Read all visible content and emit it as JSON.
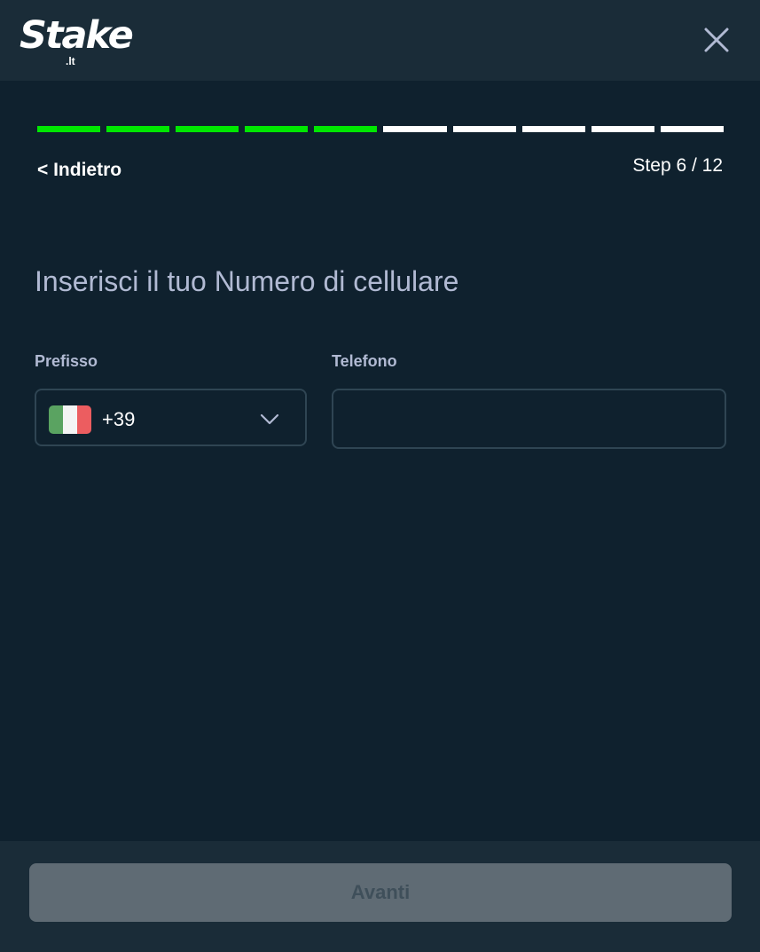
{
  "header": {
    "logo_text": "Stake",
    "logo_sub": ".lt",
    "close_icon": "close-icon"
  },
  "progress": {
    "current_step": 6,
    "total_steps": 12,
    "completed_segments": 5,
    "completed_color": "#00e701",
    "pending_color": "#ffffff"
  },
  "nav": {
    "back_label": "< Indietro",
    "step_label": "Step 6 / 12"
  },
  "form": {
    "question": "Inserisci il tuo Numero di cellulare",
    "prefix_label": "Prefisso",
    "prefix_value": "+39",
    "prefix_flag": "italy-flag-icon",
    "phone_label": "Telefono",
    "phone_value": "",
    "phone_placeholder": ""
  },
  "footer": {
    "next_label": "Avanti"
  },
  "colors": {
    "background": "#0f212e",
    "header_bg": "#1a2c38",
    "input_border": "#2f4553",
    "label_text": "#b1bad3",
    "disabled_button": "#5f6b74"
  }
}
